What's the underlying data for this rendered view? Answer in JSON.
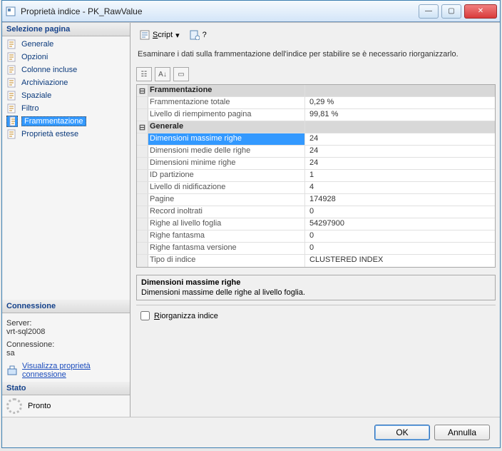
{
  "window": {
    "title": "Proprietà indice - PK_RawValue"
  },
  "sidebar": {
    "selection_title": "Selezione pagina",
    "pages": [
      {
        "label": "Generale"
      },
      {
        "label": "Opzioni"
      },
      {
        "label": "Colonne incluse"
      },
      {
        "label": "Archiviazione"
      },
      {
        "label": "Spaziale"
      },
      {
        "label": "Filtro"
      },
      {
        "label": "Frammentazione"
      },
      {
        "label": "Proprietà estese"
      }
    ],
    "connection_title": "Connessione",
    "server_label": "Server:",
    "server_value": "vrt-sql2008",
    "conn_label": "Connessione:",
    "conn_value": "sa",
    "view_conn_props": "Visualizza proprietà connessione",
    "state_title": "Stato",
    "state_value": "Pronto"
  },
  "toolbar": {
    "script_label": "Script",
    "help_label": "?"
  },
  "main": {
    "description": "Esaminare i dati sulla frammentazione dell'indice per stabilire se è necessario riorganizzarlo.",
    "groups": [
      {
        "name": "Frammentazione",
        "rows": [
          {
            "k": "Frammentazione totale",
            "v": "0,29 %"
          },
          {
            "k": "Livello di riempimento pagina",
            "v": "99,81 %"
          }
        ]
      },
      {
        "name": "Generale",
        "rows": [
          {
            "k": "Dimensioni massime righe",
            "v": "24",
            "selected": true
          },
          {
            "k": "Dimensioni medie delle righe",
            "v": "24"
          },
          {
            "k": "Dimensioni minime righe",
            "v": "24"
          },
          {
            "k": "ID partizione",
            "v": "1"
          },
          {
            "k": "Livello di nidificazione",
            "v": "4"
          },
          {
            "k": "Pagine",
            "v": "174928"
          },
          {
            "k": "Record inoltrati",
            "v": "0"
          },
          {
            "k": "Righe al livello foglia",
            "v": "54297900"
          },
          {
            "k": "Righe fantasma",
            "v": "0"
          },
          {
            "k": "Righe fantasma versione",
            "v": "0"
          },
          {
            "k": "Tipo di indice",
            "v": "CLUSTERED INDEX"
          }
        ]
      }
    ],
    "help_title": "Dimensioni massime righe",
    "help_text": "Dimensioni massime delle righe al livello foglia.",
    "reorganize_label": "Riorganizza indice"
  },
  "footer": {
    "ok": "OK",
    "cancel": "Annulla"
  }
}
